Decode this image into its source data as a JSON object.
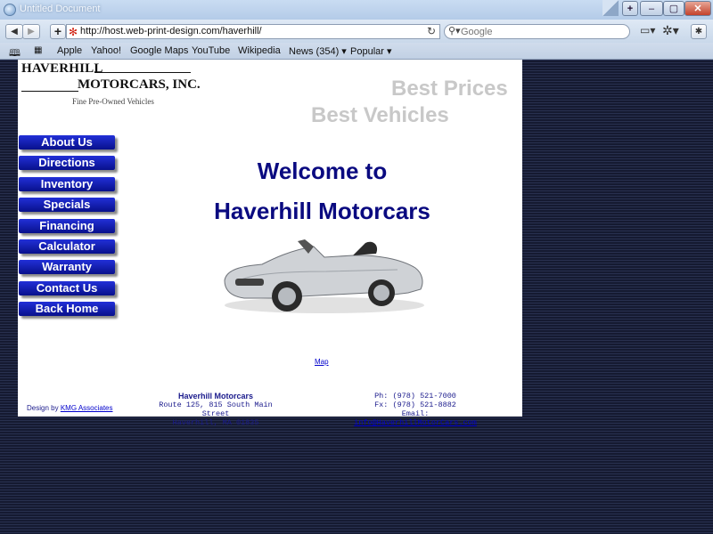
{
  "window": {
    "title": "Untitled Document",
    "buttons": {
      "new": "+",
      "minimize": "–",
      "maximize": "▢",
      "close": "✕"
    }
  },
  "toolbar": {
    "back_icon": "◀",
    "forward_icon": "▶",
    "add_icon": "+",
    "url": "http://host.web-print-design.com/haverhill/",
    "reload_icon": "↻",
    "search_icon": "🔍",
    "search_placeholder": "Google",
    "page_icon": "▭▾",
    "gear_icon": "✲▾",
    "bug_icon": "✱"
  },
  "bookmarks": {
    "book_icon": "🕮",
    "grid_icon": "▦",
    "items": [
      "Apple",
      "Yahoo!",
      "Google Maps",
      "YouTube",
      "Wikipedia",
      "News (354) ▾",
      "Popular ▾"
    ]
  },
  "logo": {
    "line1": "HAVERHILL",
    "line2": "MOTORCARS, INC.",
    "tagline": "Fine Pre-Owned Vehicles"
  },
  "slogans": {
    "prices": "Best Prices",
    "vehicles": "Best Vehicles"
  },
  "nav": [
    "About Us",
    "Directions",
    "Inventory",
    "Specials",
    "Financing",
    "Calculator",
    "Warranty",
    "Contact Us",
    "Back Home"
  ],
  "welcome": {
    "line1": "Welcome to",
    "line2": "Haverhill Motorcars"
  },
  "map_link": "Map",
  "footer": {
    "design_prefix": "Design by",
    "design_link": "KMG Associates",
    "company": "Haverhill Motorcars",
    "address1": "Route 125, 815 South Main Street",
    "address2": "Haverhill, MA 01835",
    "phone": "Ph: (978) 521-7000",
    "fax": "Fx: (978) 521-8882",
    "email_prefix": "Email:",
    "email": "info@HaverhillMotorCars.com"
  },
  "colors": {
    "nav_button": "#1a24c0",
    "heading_blue": "#0a0a80",
    "slogan_gray": "#c8c8c8",
    "page_background": "#1d2340"
  }
}
